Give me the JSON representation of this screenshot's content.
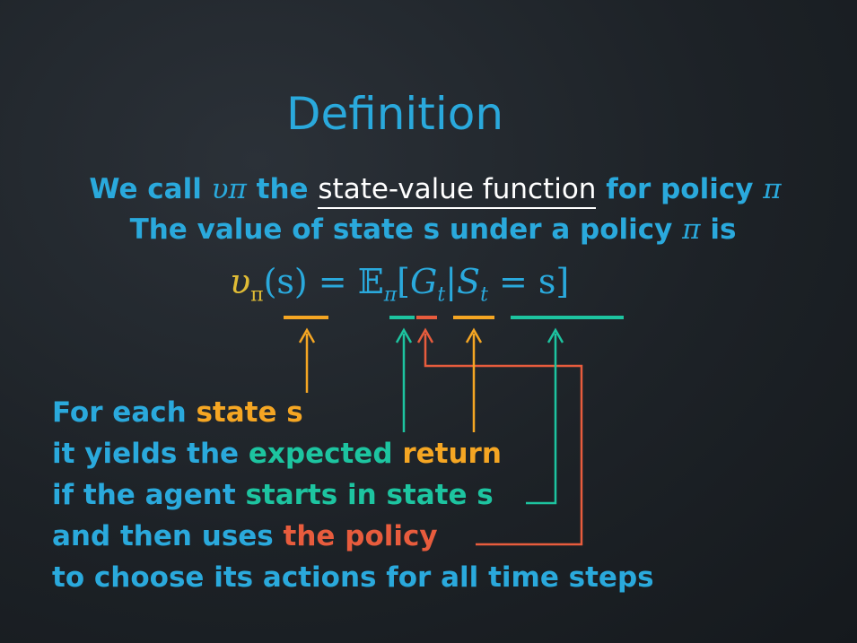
{
  "title": "Definition",
  "line1": {
    "prefix": "We call",
    "symbol": "υπ",
    "middle": "the",
    "underlined": "state-value function",
    "suffix": "for policy",
    "pi": "π"
  },
  "line2": {
    "text": "The value of state s under a policy",
    "pi": "π",
    "suffix": "is"
  },
  "formula": {
    "v": "υ",
    "v_sub": "π",
    "arg": "(s) = ",
    "E": "𝔼",
    "E_sub": "π",
    "open": "[",
    "G": "G",
    "G_sub": "t",
    "bar": "|",
    "S": "S",
    "S_sub": "t",
    "rest": " = s]"
  },
  "annotations": {
    "l1_a": "For each ",
    "l1_b": "state s",
    "l2_a": "it yields the ",
    "l2_b": "expected",
    "l2_c": " return",
    "l3_a": "if the agent ",
    "l3_b": "starts in state s",
    "l4_a": "and then uses ",
    "l4_b": "the policy",
    "l5": "to choose its actions for all time steps"
  },
  "colors": {
    "text_blue": "#2aa9dc",
    "orange": "#f5a623",
    "green": "#1dc4a0",
    "red": "#e85c3d",
    "gold": "#e0bc35"
  }
}
